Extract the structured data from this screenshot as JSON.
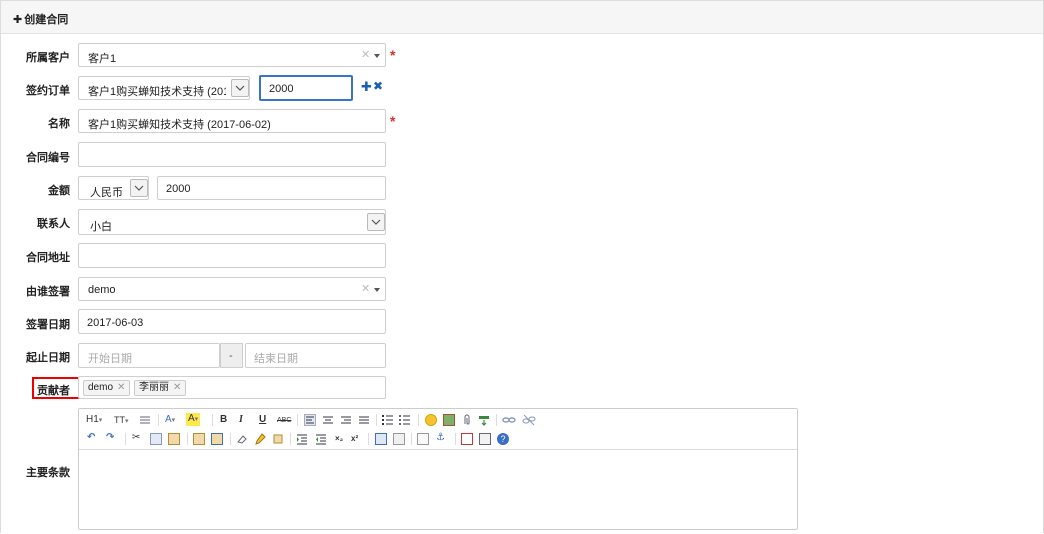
{
  "header": {
    "title": "创建合同",
    "icon": "plus-icon"
  },
  "form": {
    "customer": {
      "label": "所属客户",
      "value": "客户1"
    },
    "order": {
      "label": "签约订单",
      "select_value": "客户1购买蝉知技术支持 (201",
      "amount_value": "2000"
    },
    "name": {
      "label": "名称",
      "value": "客户1购买蝉知技术支持 (2017-06-02)"
    },
    "code": {
      "label": "合同编号",
      "value": ""
    },
    "amount": {
      "label": "金额",
      "currency": "人民币",
      "value": "2000"
    },
    "contact": {
      "label": "联系人",
      "value": "小白"
    },
    "address": {
      "label": "合同地址",
      "value": ""
    },
    "signed_by": {
      "label": "由谁签署",
      "value": "demo"
    },
    "signed_date": {
      "label": "签署日期",
      "value": "2017-06-03"
    },
    "period": {
      "label": "起止日期",
      "start_placeholder": "开始日期",
      "separator": "-",
      "end_placeholder": "结束日期"
    },
    "contributors": {
      "label": "贡献者",
      "tags": [
        "demo",
        "李丽丽"
      ]
    },
    "terms": {
      "label": "主要条款",
      "toolbar_row1": [
        "H1",
        "TT",
        "A",
        "A",
        "B",
        "I",
        "U",
        "ABC"
      ],
      "toolbar_row2": [
        "×₂",
        "x²"
      ]
    }
  },
  "colors": {
    "required": "#d9302a",
    "highlight": "#e00000",
    "focus_border": "#3a74c9",
    "action_blue": "#1a5fb4"
  }
}
